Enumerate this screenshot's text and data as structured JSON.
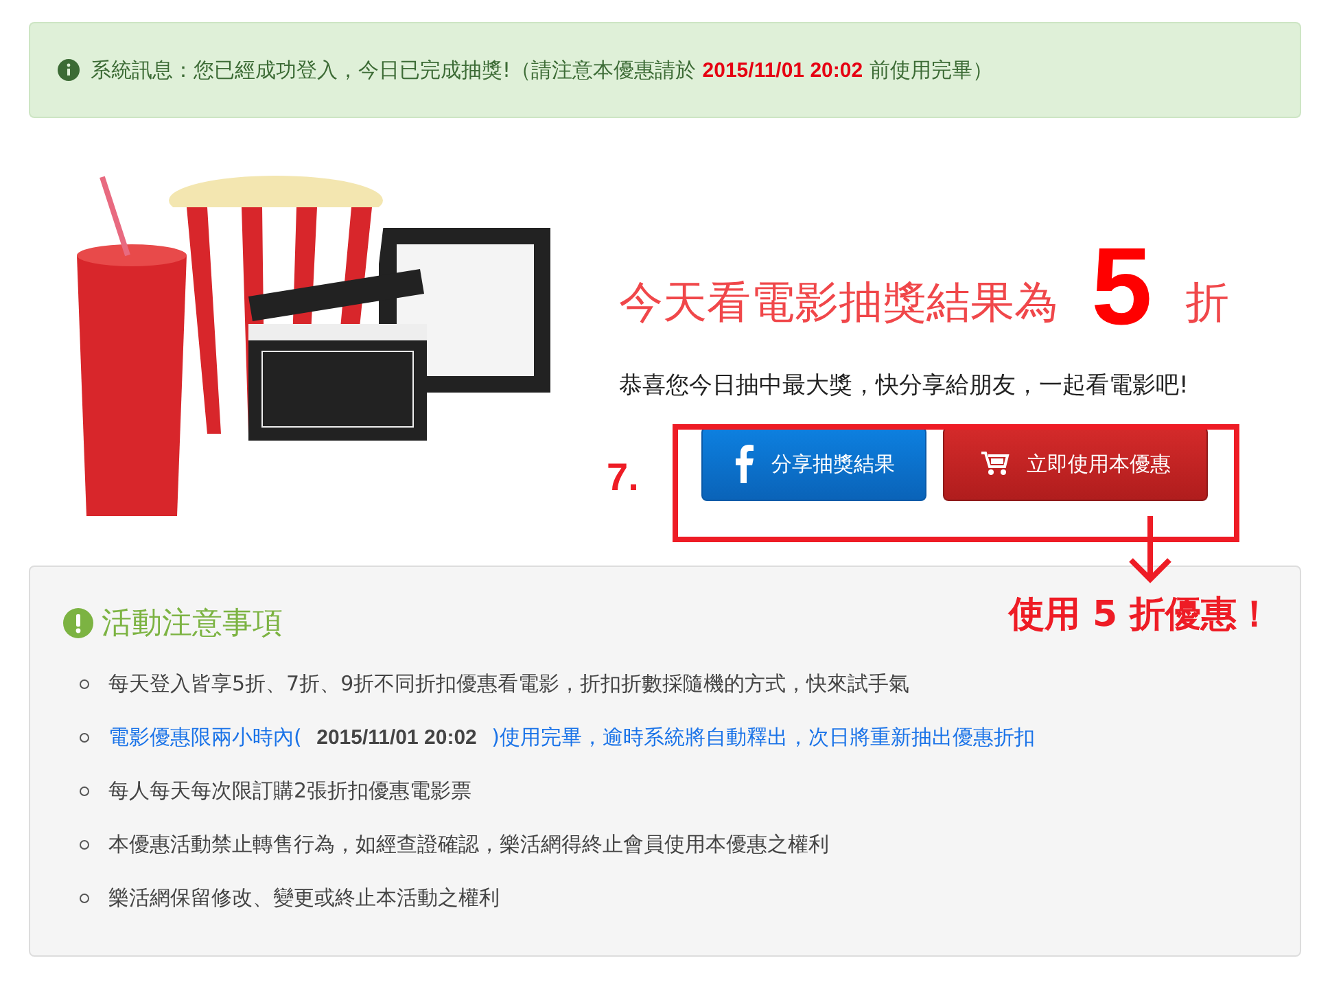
{
  "alert": {
    "kind": "success",
    "message": "系統訊息：您已經成功登入，今日已完成抽獎!（請注意本優惠請於 **2015/11/01 20:02** 前使用完畢）"
  },
  "result": {
    "headline": "今天看電影抽獎結果為",
    "discount": "5",
    "unit": "折",
    "congrats": "恭喜您今日抽中最大獎，快分享給朋友，一起看電影吧!",
    "buttons": [
      {
        "kind": "facebook",
        "label": "分享抽獎結果"
      },
      {
        "kind": "cart",
        "label": "立即使用本優惠"
      }
    ]
  },
  "notes": {
    "title": "活動注意事項",
    "items": [
      {
        "kind": "normal",
        "text": "每天登入皆享5折、7折、9折不同折扣優惠看電影，折扣折數採隨機的方式，快來試手氣"
      },
      {
        "kind": "highlight",
        "text": "電影優惠限兩小時內( **2015/11/01 20:02** )使用完畢，逾時系統將自動釋出，次日將重新抽出優惠折扣"
      },
      {
        "kind": "normal",
        "text": "每人每天每次限訂購2張折扣優惠電影票"
      },
      {
        "kind": "normal",
        "text": "本優惠活動禁止轉售行為，如經查證確認，樂活網得終止會員使用本優惠之權利"
      },
      {
        "kind": "normal",
        "text": "樂活網保留修改、變更或終止本活動之權利"
      }
    ]
  },
  "annotation": {
    "step": "7.",
    "callout": "使用 5 折優惠！"
  }
}
